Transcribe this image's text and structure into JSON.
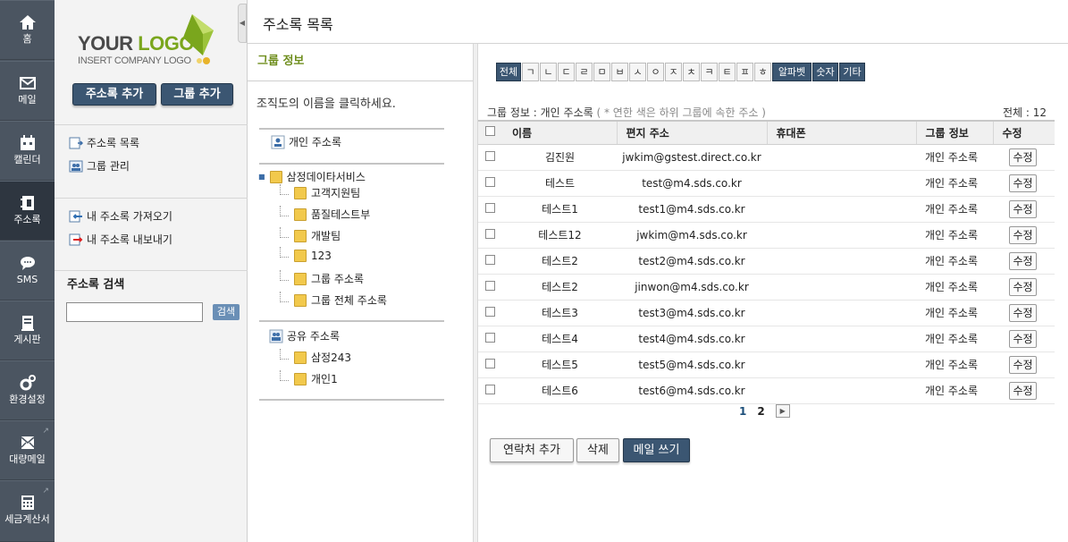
{
  "rail": [
    {
      "label": "홈",
      "icon": "home-icon"
    },
    {
      "label": "메일",
      "icon": "mail-icon"
    },
    {
      "label": "캘린더",
      "icon": "calendar-icon"
    },
    {
      "label": "주소록",
      "icon": "addressbook-icon"
    },
    {
      "label": "SMS",
      "icon": "sms-icon"
    },
    {
      "label": "게시판",
      "icon": "board-icon"
    },
    {
      "label": "환경설정",
      "icon": "settings-icon"
    },
    {
      "label": "대량메일",
      "icon": "bulkmail-icon"
    },
    {
      "label": "세금계산서",
      "icon": "calculator-icon"
    }
  ],
  "logo": {
    "your": "YOUR",
    "logo": "LOGO",
    "insert": "INSERT COMPANY LOGO"
  },
  "sidebar": {
    "add_contact_btn": "주소록 추가",
    "add_group_btn": "그룹 추가",
    "menu": [
      "주소록 목록",
      "그룹 관리"
    ],
    "io": [
      "내 주소록 가져오기",
      "내 주소록 내보내기"
    ],
    "search_title": "주소록 검색",
    "search_value": "",
    "search_btn": "검색"
  },
  "header": {
    "title": "주소록 목록"
  },
  "tree": {
    "head": "그룹 정보",
    "hint": "조직도의 이름을 클릭하세요.",
    "personal": "개인 주소록",
    "org": "삼정데이타서비스",
    "org_children": [
      "고객지원팀",
      "품질테스트부",
      "개발팀",
      "123",
      "그룹 주소록",
      "그룹 전체 주소록"
    ],
    "shared": "공유 주소록",
    "shared_children": [
      "삼정243",
      "개인1"
    ]
  },
  "alphabet": [
    "전체",
    "ㄱ",
    "ㄴ",
    "ㄷ",
    "ㄹ",
    "ㅁ",
    "ㅂ",
    "ㅅ",
    "ㅇ",
    "ㅈ",
    "ㅊ",
    "ㅋ",
    "ㅌ",
    "ㅍ",
    "ㅎ",
    "알파벳",
    "숫자",
    "기타"
  ],
  "info": {
    "label": "그룹 정보 : 개인 주소록",
    "note": "( * 연한 색은 하위 그룹에 속한 주소 )",
    "total": "전체 : 12"
  },
  "table": {
    "headers": [
      "이름",
      "편지 주소",
      "휴대폰",
      "그룹 정보",
      "수정"
    ],
    "rows": [
      {
        "name": "김진원",
        "email": "jwkim@gstest.direct.co.kr",
        "phone": "",
        "group": "개인 주소록",
        "edit": "수정"
      },
      {
        "name": "테스트",
        "email": "test@m4.sds.co.kr",
        "phone": "",
        "group": "개인 주소록",
        "edit": "수정"
      },
      {
        "name": "테스트1",
        "email": "test1@m4.sds.co.kr",
        "phone": "",
        "group": "개인 주소록",
        "edit": "수정"
      },
      {
        "name": "테스트12",
        "email": "jwkim@m4.sds.co.kr",
        "phone": "",
        "group": "개인 주소록",
        "edit": "수정"
      },
      {
        "name": "테스트2",
        "email": "test2@m4.sds.co.kr",
        "phone": "",
        "group": "개인 주소록",
        "edit": "수정"
      },
      {
        "name": "테스트2",
        "email": "jinwon@m4.sds.co.kr",
        "phone": "",
        "group": "개인 주소록",
        "edit": "수정"
      },
      {
        "name": "테스트3",
        "email": "test3@m4.sds.co.kr",
        "phone": "",
        "group": "개인 주소록",
        "edit": "수정"
      },
      {
        "name": "테스트4",
        "email": "test4@m4.sds.co.kr",
        "phone": "",
        "group": "개인 주소록",
        "edit": "수정"
      },
      {
        "name": "테스트5",
        "email": "test5@m4.sds.co.kr",
        "phone": "",
        "group": "개인 주소록",
        "edit": "수정"
      },
      {
        "name": "테스트6",
        "email": "test6@m4.sds.co.kr",
        "phone": "",
        "group": "개인 주소록",
        "edit": "수정"
      }
    ]
  },
  "pager": {
    "pages": [
      "1",
      "2"
    ],
    "current": "1"
  },
  "actions": {
    "add": "연락처 추가",
    "delete": "삭제",
    "mail": "메일 쓰기"
  }
}
